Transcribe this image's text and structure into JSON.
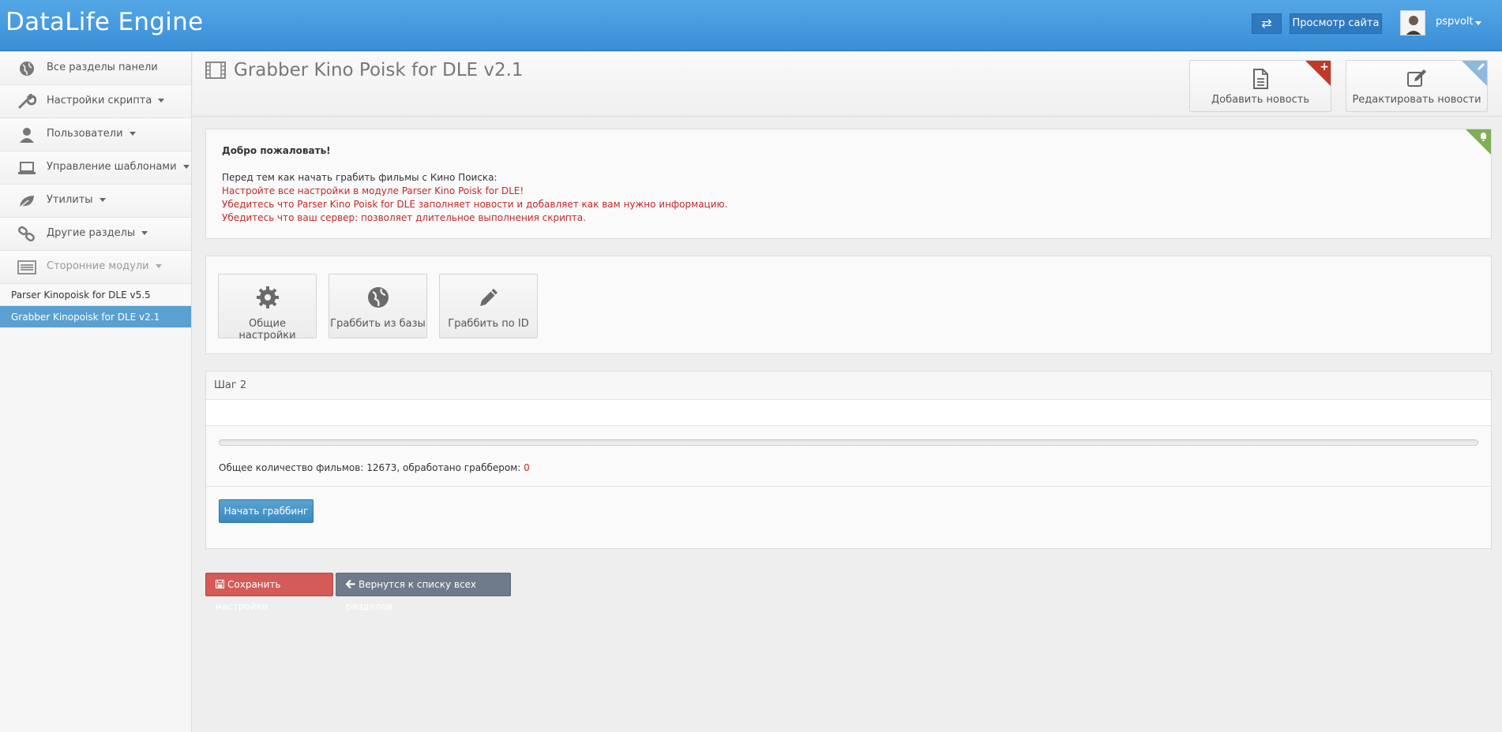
{
  "header": {
    "brand": "DataLife Engine",
    "swap_symbol": "⇄",
    "view_site_label": "Просмотр сайта",
    "username": "pspvolt"
  },
  "sidebar": {
    "items": [
      {
        "label": "Все разделы панели",
        "icon": "globe-icon",
        "has_caret": false
      },
      {
        "label": "Настройки скрипта",
        "icon": "wrench-icon",
        "has_caret": true
      },
      {
        "label": "Пользователи",
        "icon": "user-icon",
        "has_caret": true
      },
      {
        "label": "Управление шаблонами",
        "icon": "laptop-icon",
        "has_caret": true
      },
      {
        "label": "Утилиты",
        "icon": "leaf-icon",
        "has_caret": true
      },
      {
        "label": "Другие разделы",
        "icon": "link-icon",
        "has_caret": true
      },
      {
        "label": "Сторонние модули",
        "icon": "list-icon",
        "has_caret": true
      }
    ],
    "sub_items": [
      {
        "label": "Parser Kinopoisk for DLE v5.5",
        "active": false
      },
      {
        "label": "Grabber Kinopoisk for DLE v2.1",
        "active": true
      }
    ]
  },
  "page": {
    "title": "Grabber Kino Poisk for DLE v2.1",
    "add_news_label": "Добавить новость",
    "edit_news_label": "Редактировать новости"
  },
  "welcome": {
    "title": "Добро пожаловать!",
    "intro": "Перед тем как начать грабить фильмы с Кино Поиска:",
    "lines": [
      "Настройте все настройки в модуле Parser Kino Poisk for DLE!",
      "Убедитесь что Parser Kino Poisk for DLE заполняет новости и добавляет как вам нужно информацию.",
      "Убедитесь что ваш сервер: позволяет длительное выполнения скрипта."
    ]
  },
  "tools": [
    {
      "label": "Общие настройки",
      "icon": "gear-icon"
    },
    {
      "label": "Граббить из базы",
      "icon": "globe-icon"
    },
    {
      "label": "Граббить по ID",
      "icon": "pencil-icon"
    }
  ],
  "step": {
    "title": "Шаг 2",
    "progress_percent": 0,
    "count_text": "Общее количество фильмов: 12673, обработано граббером: ",
    "processed": "0",
    "start_label": "Начать граббинг"
  },
  "footer_buttons": {
    "save_label": "Сохранить настройки",
    "back_label": "Вернутся к списку всех разделов"
  },
  "colors": {
    "header": "#4a9ee0",
    "active_sub": "#5aa0d0",
    "red_text": "#c02a2a",
    "save": "#d45b57",
    "back": "#6f7a8b",
    "primary": "#3a89c0"
  }
}
